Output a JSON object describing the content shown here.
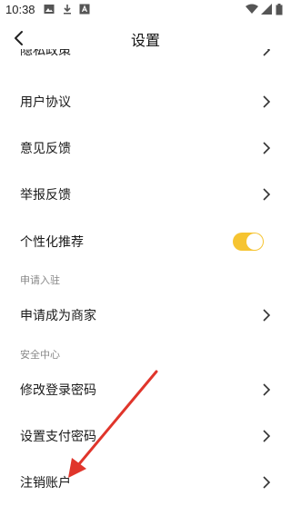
{
  "status_bar": {
    "time": "10:38",
    "left_icons": [
      "image-icon",
      "download-icon",
      "a-box-icon"
    ],
    "right_icons": [
      "wifi-icon",
      "signal-icon",
      "battery-icon"
    ]
  },
  "nav": {
    "title": "设置",
    "back_icon": "chevron-left-icon"
  },
  "settings": {
    "partial_item": "隐私政策",
    "items": [
      {
        "label": "用户协议"
      },
      {
        "label": "意见反馈"
      },
      {
        "label": "举报反馈"
      }
    ],
    "personalized": {
      "label": "个性化推荐",
      "enabled": true
    },
    "section_merchant": "申请入驻",
    "merchant_item": "申请成为商家",
    "section_security": "安全中心",
    "security_items": [
      {
        "label": "修改登录密码"
      },
      {
        "label": "设置支付密码"
      },
      {
        "label": "注销账户"
      }
    ]
  },
  "colors": {
    "toggle_on": "#f6c431",
    "annotation_arrow": "#e0352b"
  }
}
